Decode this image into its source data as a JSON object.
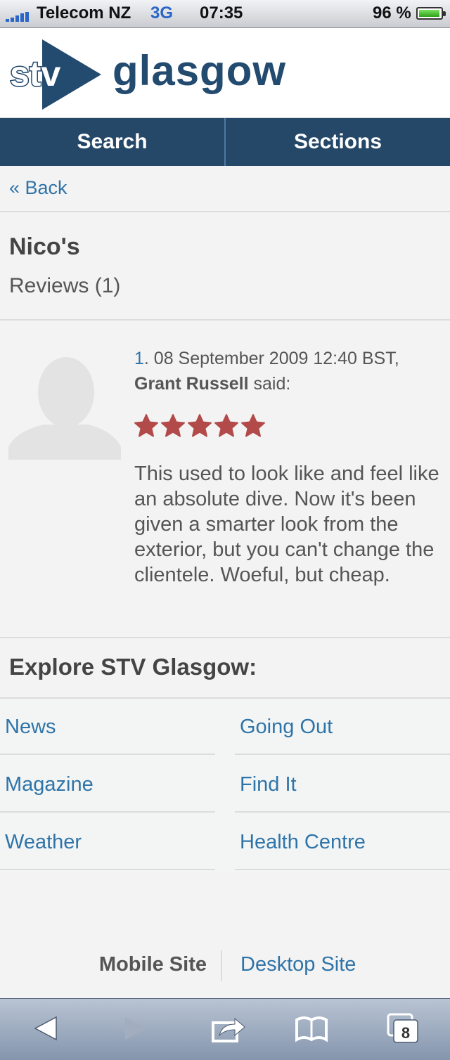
{
  "status_bar": {
    "carrier": "Telecom NZ",
    "network": "3G",
    "time": "07:35",
    "battery": "96 %",
    "battery_level": 0.96
  },
  "header": {
    "logo_text": "stv",
    "site_name": "glasgow"
  },
  "nav": {
    "search_label": "Search",
    "sections_label": "Sections"
  },
  "back_label": "« Back",
  "venue": {
    "name": "Nico's",
    "reviews_label": "Reviews (1)"
  },
  "review": {
    "number": "1",
    "date": ". 08 September 2009 12:40 BST,",
    "author": "Grant Russell",
    "said": " said:",
    "rating": 5,
    "rating_max": 5,
    "star_color": "#b24a4a",
    "text": "This used to look like and feel like an absolute dive. Now it's been given a smarter look from the exterior, but you can't change the clientele. Woeful, but cheap."
  },
  "explore": {
    "heading": "Explore STV Glasgow:",
    "links": [
      [
        "News",
        "Going Out"
      ],
      [
        "Magazine",
        "Find It"
      ],
      [
        "Weather",
        "Health Centre"
      ]
    ]
  },
  "footer": {
    "mobile_label": "Mobile Site",
    "desktop_label": "Desktop Site"
  },
  "toolbar": {
    "tabs_count": "8",
    "icons": [
      "back-arrow-icon",
      "forward-arrow-icon",
      "share-icon",
      "bookmarks-icon",
      "tabs-icon"
    ]
  },
  "colors": {
    "brand": "#234a6f",
    "nav_bg": "#254869",
    "link": "#2f74a8"
  }
}
